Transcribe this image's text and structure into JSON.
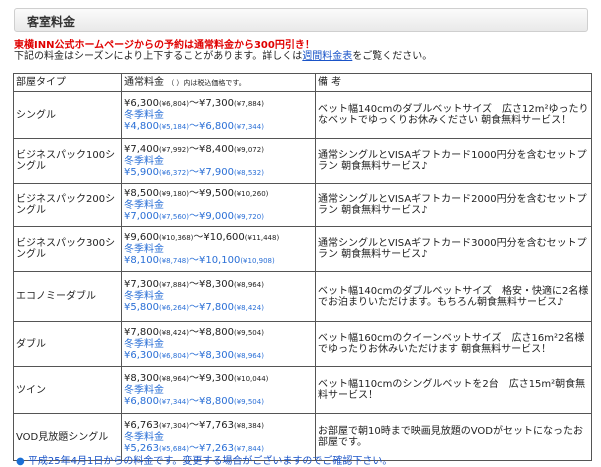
{
  "header": {
    "title": "客室料金"
  },
  "notice": {
    "line1": "東横INN公式ホームページからの予約は通常料金から300円引き！",
    "line2_pre": "下記の料金はシーズンにより上下することがあります。詳しくは",
    "line2_link": "週間料金表",
    "line2_post": "をご覧ください。"
  },
  "table": {
    "headers": {
      "type": "部屋タイプ",
      "price_main": "通常料金",
      "price_note": "（ ）内は税込価格です。",
      "notes": "備 考"
    },
    "rows": [
      {
        "type": "シングル",
        "normal_from": "¥6,300",
        "normal_from_tax": "(¥6,804)",
        "normal_to": "¥7,300",
        "normal_to_tax": "(¥7,884)",
        "winter_label": "冬季料金",
        "winter_from": "¥4,800",
        "winter_from_tax": "(¥5,184)",
        "winter_to": "¥6,800",
        "winter_to_tax": "(¥7,344)",
        "notes": "ベット幅140cmのダブルベットサイズ　広さ12m²ゆったりなベットでゆっくりお休みください 朝食無料サービス！"
      },
      {
        "type": "ビジネスパック100シングル",
        "normal_from": "¥7,400",
        "normal_from_tax": "(¥7,992)",
        "normal_to": "¥8,400",
        "normal_to_tax": "(¥9,072)",
        "winter_label": "冬季料金",
        "winter_from": "¥5,900",
        "winter_from_tax": "(¥6,372)",
        "winter_to": "¥7,900",
        "winter_to_tax": "(¥8,532)",
        "notes": "通常シングルとVISAギフトカード1000円分を含むセットプラン 朝食無料サービス♪"
      },
      {
        "type": "ビジネスパック200シングル",
        "normal_from": "¥8,500",
        "normal_from_tax": "(¥9,180)",
        "normal_to": "¥9,500",
        "normal_to_tax": "(¥10,260)",
        "winter_label": "冬季料金",
        "winter_from": "¥7,000",
        "winter_from_tax": "(¥7,560)",
        "winter_to": "¥9,000",
        "winter_to_tax": "(¥9,720)",
        "notes": "通常シングルとVISAギフトカード2000円分を含むセットプラン 朝食無料サービス♪"
      },
      {
        "type": "ビジネスパック300シングル",
        "normal_from": "¥9,600",
        "normal_from_tax": "(¥10,368)",
        "normal_to": "¥10,600",
        "normal_to_tax": "(¥11,448)",
        "winter_label": "冬季料金",
        "winter_from": "¥8,100",
        "winter_from_tax": "(¥8,748)",
        "winter_to": "¥10,100",
        "winter_to_tax": "(¥10,908)",
        "notes": "通常シングルとVISAギフトカード3000円分を含むセットプラン 朝食無料サービス♪"
      },
      {
        "type": "エコノミーダブル",
        "normal_from": "¥7,300",
        "normal_from_tax": "(¥7,884)",
        "normal_to": "¥8,300",
        "normal_to_tax": "(¥8,964)",
        "winter_label": "冬季料金",
        "winter_from": "¥5,800",
        "winter_from_tax": "(¥6,264)",
        "winter_to": "¥7,800",
        "winter_to_tax": "(¥8,424)",
        "notes": "ベット幅140cmのダブルベットサイズ　格安・快適に2名様でお泊まりいただけます。もちろん朝食無料サービス♪"
      },
      {
        "type": "ダブル",
        "normal_from": "¥7,800",
        "normal_from_tax": "(¥8,424)",
        "normal_to": "¥8,800",
        "normal_to_tax": "(¥9,504)",
        "winter_label": "冬季料金",
        "winter_from": "¥6,300",
        "winter_from_tax": "(¥6,804)",
        "winter_to": "¥8,300",
        "winter_to_tax": "(¥8,964)",
        "notes": "ベット幅160cmのクイーンベットサイズ　広さ16m²2名様でゆったりお休みいただけます 朝食無料サービス！"
      },
      {
        "type": "ツイン",
        "normal_from": "¥8,300",
        "normal_from_tax": "(¥8,964)",
        "normal_to": "¥9,300",
        "normal_to_tax": "(¥10,044)",
        "winter_label": "冬季料金",
        "winter_from": "¥6,800",
        "winter_from_tax": "(¥7,344)",
        "winter_to": "¥8,800",
        "winter_to_tax": "(¥9,504)",
        "notes": "ベット幅110cmのシングルベットを2台　広さ15m²朝食無料サービス！"
      },
      {
        "type": "VOD見放題シングル",
        "normal_from": "¥6,763",
        "normal_from_tax": "(¥7,304)",
        "normal_to": "¥7,763",
        "normal_to_tax": "(¥8,384)",
        "winter_label": "冬季料金",
        "winter_from": "¥5,263",
        "winter_from_tax": "(¥5,684)",
        "winter_to": "¥7,263",
        "winter_to_tax": "(¥7,844)",
        "notes": "お部屋で朝10時まで映画見放題のVODがセットになったお部屋です。"
      }
    ]
  },
  "footer": {
    "bullet": "●",
    "text": "平成25年4月1日からの料金です。変更する場合がございますのでご確認下さい。"
  },
  "colors": {
    "accent_red": "#e00000",
    "link_blue": "#1a54c8",
    "winter_blue": "#2a6fd6"
  }
}
